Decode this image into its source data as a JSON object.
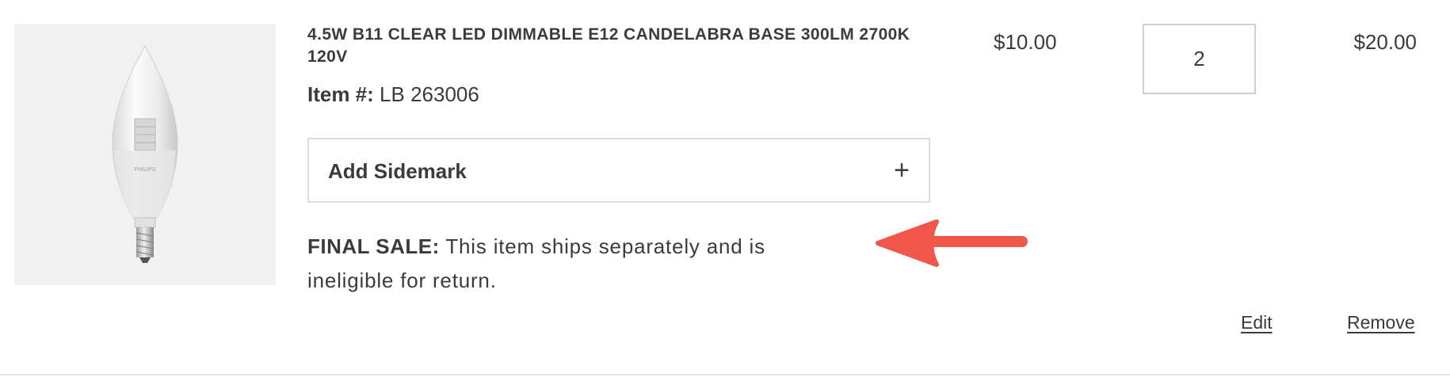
{
  "product": {
    "title": "4.5W B11 CLEAR LED DIMMABLE E12 CANDELABRA BASE 300LM 2700K 120V",
    "item_label": "Item #:",
    "item_number": "LB 263006",
    "image_icon": "led-candelabra-bulb-image",
    "brand_mark": "PHILIPS"
  },
  "sidemark": {
    "label": "Add Sidemark",
    "icon": "plus-icon",
    "icon_glyph": "+"
  },
  "notice": {
    "label": "FINAL SALE:",
    "text": " This item ships separately and is ineligible for return.",
    "arrow_color": "#f0564a"
  },
  "pricing": {
    "unit_price": "$10.00",
    "quantity": "2",
    "total": "$20.00"
  },
  "actions": {
    "edit_label": "Edit",
    "remove_label": "Remove"
  }
}
